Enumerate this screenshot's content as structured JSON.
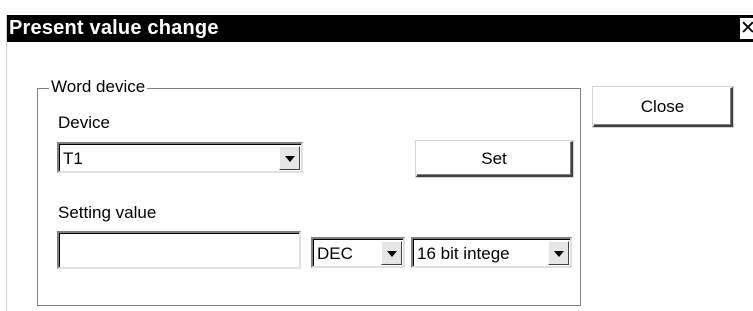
{
  "window": {
    "title": "Present value change",
    "close_glyph": "✕"
  },
  "group": {
    "legend": "Word device",
    "device_label": "Device",
    "device_value": "T1",
    "setting_label": "Setting value",
    "setting_value": "",
    "format_value": "DEC",
    "type_value": "16 bit intege"
  },
  "buttons": {
    "set": "Set",
    "close": "Close"
  }
}
